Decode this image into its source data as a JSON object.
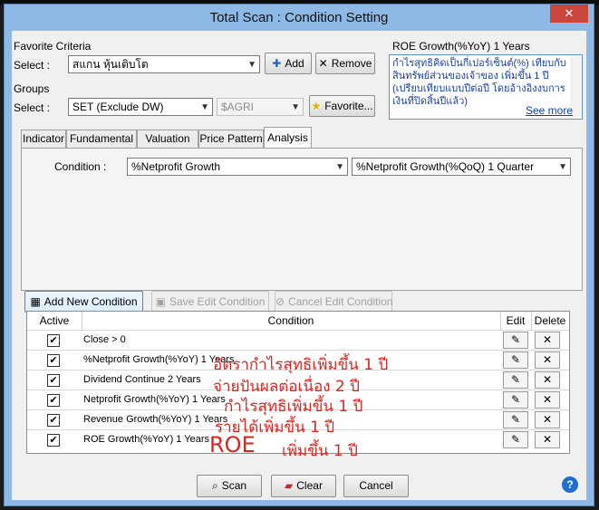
{
  "window": {
    "title": "Total Scan : Condition Setting",
    "close_glyph": "✕"
  },
  "favorite": {
    "group_label": "Favorite Criteria",
    "select_label": "Select :",
    "selected": "สแกน หุ้นเติบโต",
    "add_label": "Add",
    "remove_label": "Remove"
  },
  "groups": {
    "group_label": "Groups",
    "select_label": "Select :",
    "selected": "SET (Exclude DW)",
    "secondary": "$AGRI",
    "favorite_label": "Favorite..."
  },
  "description": {
    "title": "ROE Growth(%YoY) 1 Years",
    "text": "กำไรสุทธิคิดเป็นกี่เปอร์เซ็นต์(%) เทียบกับสินทรัพย์ส่วนของเจ้าของ เพิ่มขึ้น 1 ปี (เปรียบเทียบแบบปีต่อปี โดยอ้างอิงงบการเงินที่ปิดสิ้นปีแล้ว)",
    "see_more": "See more"
  },
  "tabs": [
    "Indicator",
    "Fundamental",
    "Valuation",
    "Price Pattern",
    "Analysis"
  ],
  "active_tab": "Analysis",
  "condition": {
    "label": "Condition :",
    "primary": "%Netprofit Growth",
    "secondary": "%Netprofit Growth(%QoQ) 1 Quarter"
  },
  "actions": {
    "add_new": "Add New Condition",
    "save_edit": "Save Edit Condition",
    "cancel_edit": "Cancel Edit Condition"
  },
  "grid": {
    "headers": {
      "active": "Active",
      "condition": "Condition",
      "edit": "Edit",
      "delete": "Delete"
    },
    "rows": [
      {
        "active": "✔",
        "condition": "Close > 0"
      },
      {
        "active": "✔",
        "condition": "%Netprofit Growth(%YoY) 1 Years"
      },
      {
        "active": "✔",
        "condition": "Dividend Continue 2 Years"
      },
      {
        "active": "✔",
        "condition": "Netprofit Growth(%YoY) 1 Years"
      },
      {
        "active": "✔",
        "condition": "Revenue Growth(%YoY) 1 Years"
      },
      {
        "active": "✔",
        "condition": "ROE Growth(%YoY) 1 Years"
      }
    ]
  },
  "annotations": [
    "อัตรากำไรสุทธิเพิ่มขึ้น 1 ปี",
    "จ่ายปันผลต่อเนื่อง 2 ปี",
    "กำไรสุทธิเพิ่มขึ้น 1 ปี",
    "รายได้เพิ่มขึ้น 1 ปี",
    "ROE",
    "เพิ่มขึ้น 1 ปี"
  ],
  "footer": {
    "scan": "Scan",
    "clear": "Clear",
    "cancel": "Cancel",
    "help": "?"
  },
  "icons": {
    "edit": "✎",
    "delete": "✕"
  }
}
